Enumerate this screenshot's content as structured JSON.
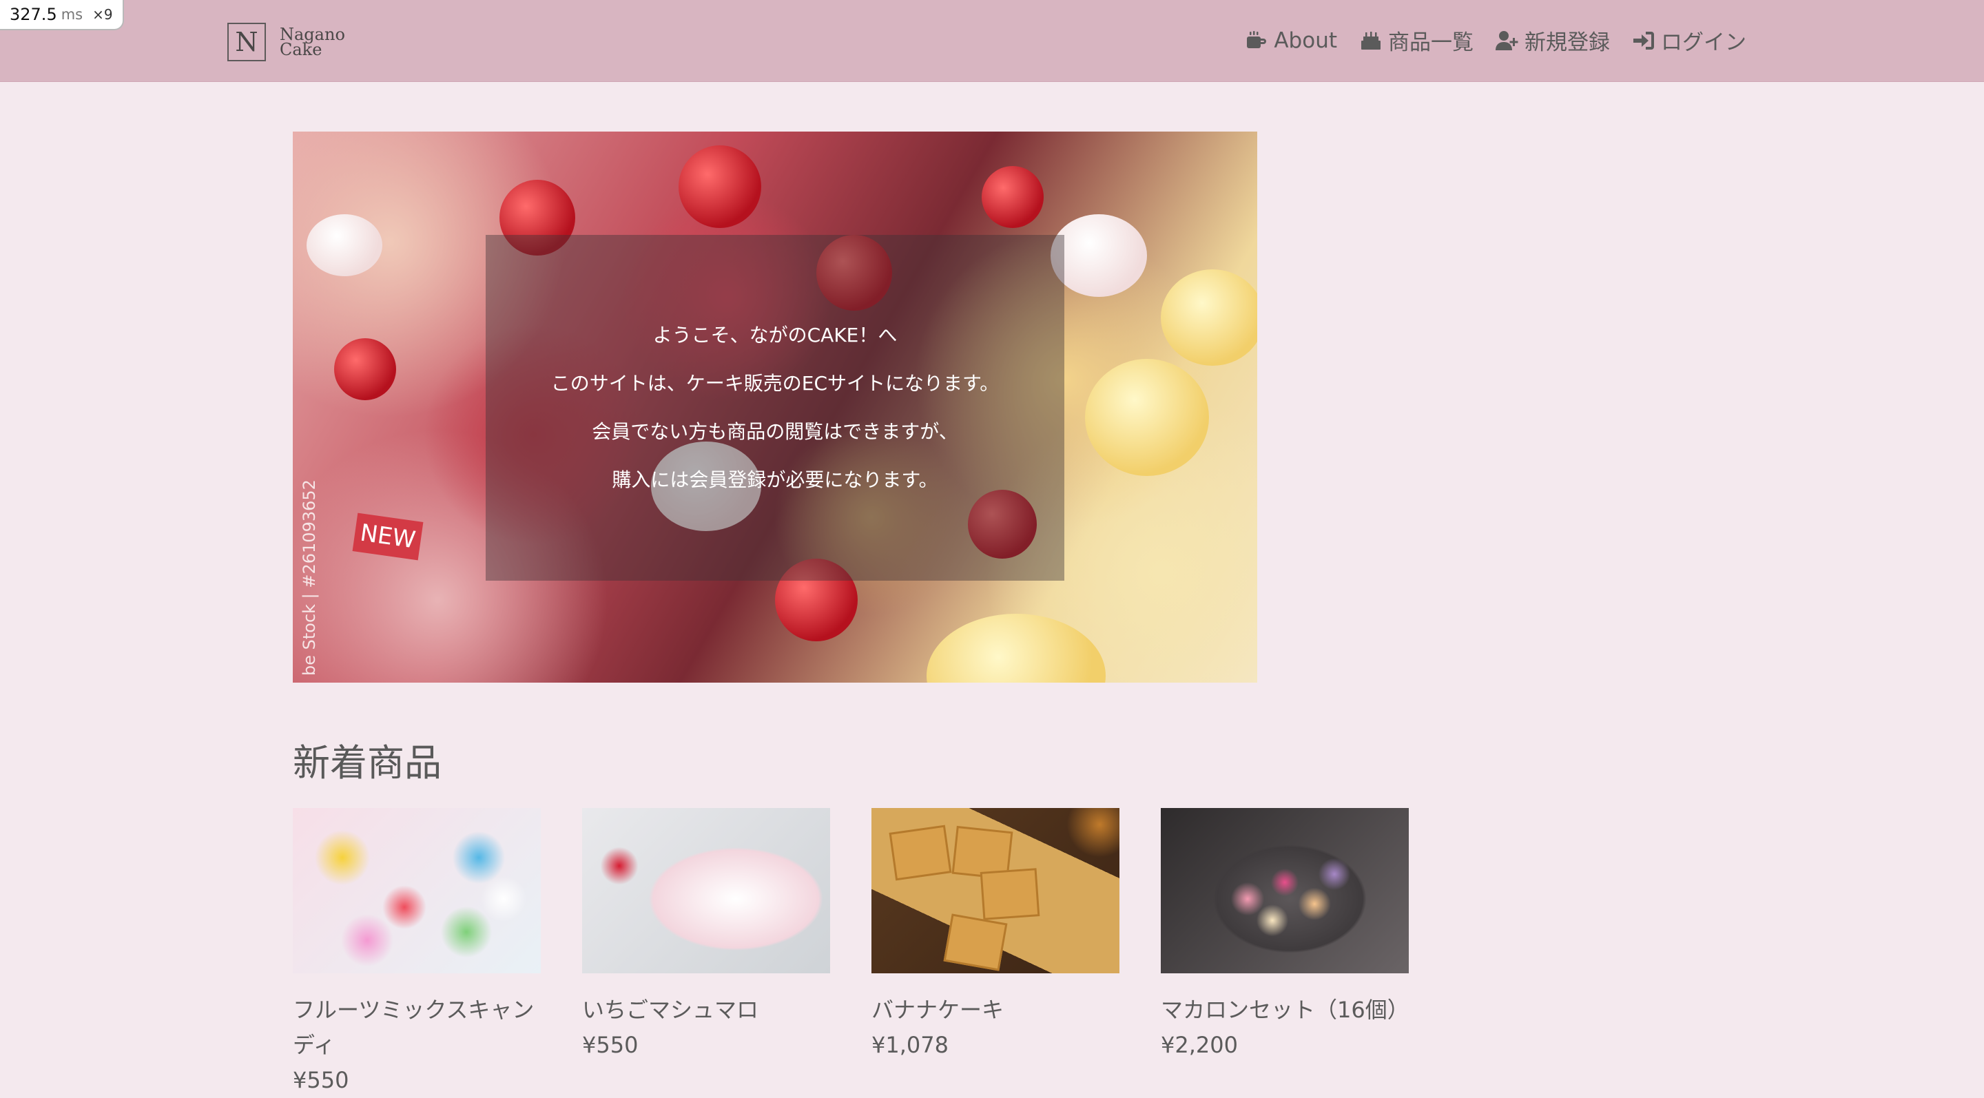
{
  "perf": {
    "value": "327.5",
    "unit": "ms",
    "multiplier": "×9"
  },
  "brand": {
    "letter": "N",
    "line1": "Nagano",
    "line2": "Cake"
  },
  "nav": [
    {
      "label": "About",
      "icon": "coffee-mug-icon"
    },
    {
      "label": "商品一覧",
      "icon": "birthday-cake-icon"
    },
    {
      "label": "新規登録",
      "icon": "user-plus-icon"
    },
    {
      "label": "ログイン",
      "icon": "sign-in-icon"
    }
  ],
  "hero": {
    "watermark": "be Stock | #261093652",
    "new_tag": "NEW",
    "lines": [
      "ようこそ、ながのCAKE！へ",
      "このサイトは、ケーキ販売のECサイトになります。",
      "会員でない方も商品の閲覧はできますが、",
      "購入には会員登録が必要になります。"
    ]
  },
  "section": {
    "title": "新着商品"
  },
  "products": [
    {
      "name_line1": "フルーツミックスキャン",
      "name_line2": "ディ",
      "price": "¥550"
    },
    {
      "name_line1": "いちごマシュマロ",
      "name_line2": "",
      "price": "¥550"
    },
    {
      "name_line1": "バナナケーキ",
      "name_line2": "",
      "price": "¥1,078"
    },
    {
      "name_line1": "マカロンセット（16個）",
      "name_line2": "",
      "price": "¥2,200"
    }
  ],
  "colors": {
    "header": "#d8b5c1",
    "background": "#f4e9ee",
    "text": "#5b5b5b"
  }
}
